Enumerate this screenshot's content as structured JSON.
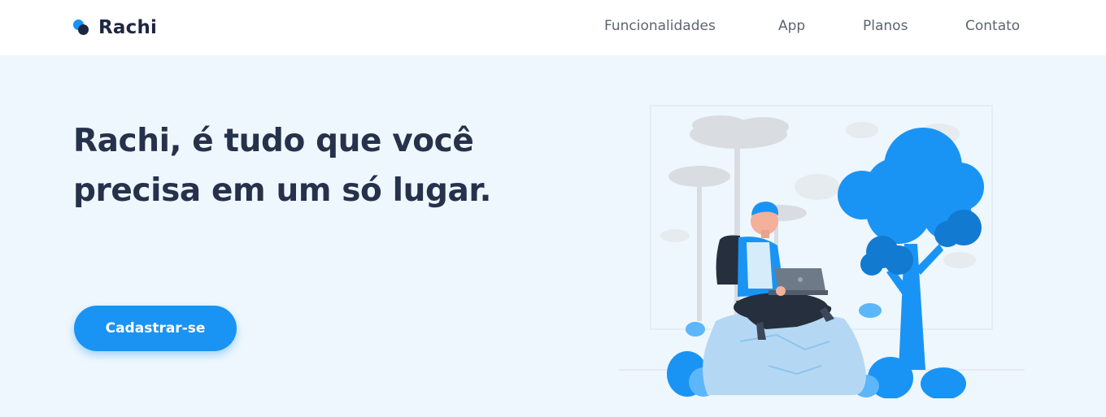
{
  "brand": {
    "name": "Rachi"
  },
  "nav": {
    "items": [
      "Funcionalidades",
      "App",
      "Planos",
      "Contato"
    ]
  },
  "hero": {
    "headline_line1": "Rachi, é tudo que você",
    "headline_line2": "precisa em um só lugar.",
    "cta_label": "Cadastrar-se"
  },
  "colors": {
    "accent": "#1a94f4",
    "dark": "#1e2740",
    "hero_bg": "#eef7fd",
    "text": "#26324b",
    "nav_text": "#5d6470"
  },
  "icons": {
    "logo": "two-overlapping-dots-logo-icon",
    "illustration": "person-with-laptop-under-tree"
  }
}
